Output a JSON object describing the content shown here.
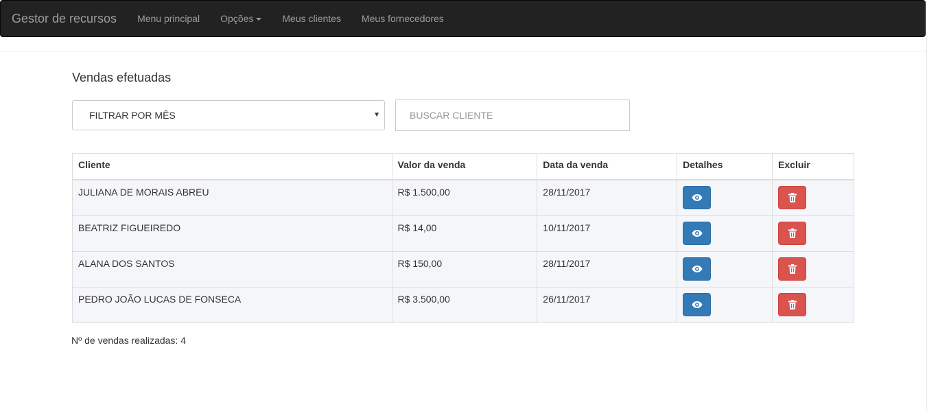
{
  "navbar": {
    "brand": "Gestor de recursos",
    "items": [
      {
        "label": "Menu principal"
      },
      {
        "label": "Opções",
        "dropdown": true
      },
      {
        "label": "Meus clientes"
      },
      {
        "label": "Meus fornecedores"
      }
    ]
  },
  "page": {
    "title": "Vendas efetuadas"
  },
  "filters": {
    "month_select_value": "FILTRAR POR MÊS",
    "client_search_placeholder": "BUSCAR CLIENTE"
  },
  "table": {
    "headers": [
      "Cliente",
      "Valor da venda",
      "Data da venda",
      "Detalhes",
      "Excluir"
    ],
    "rows": [
      {
        "cliente": "JULIANA DE MORAIS ABREU",
        "valor": "R$ 1.500,00",
        "data": "28/11/2017"
      },
      {
        "cliente": "BEATRIZ FIGUEIREDO",
        "valor": "R$ 14,00",
        "data": "10/11/2017"
      },
      {
        "cliente": "ALANA DOS SANTOS",
        "valor": "R$ 150,00",
        "data": "28/11/2017"
      },
      {
        "cliente": "PEDRO JOÃO LUCAS DE FONSECA",
        "valor": "R$ 3.500,00",
        "data": "26/11/2017"
      }
    ],
    "detail_icon": "eye-icon",
    "delete_icon": "trash-icon"
  },
  "summary": {
    "count_text": "Nº de vendas realizadas: 4"
  },
  "colors": {
    "navbar_bg": "#222222",
    "primary": "#337ab7",
    "danger": "#d9534f",
    "row_bg": "#f5f6fa"
  }
}
